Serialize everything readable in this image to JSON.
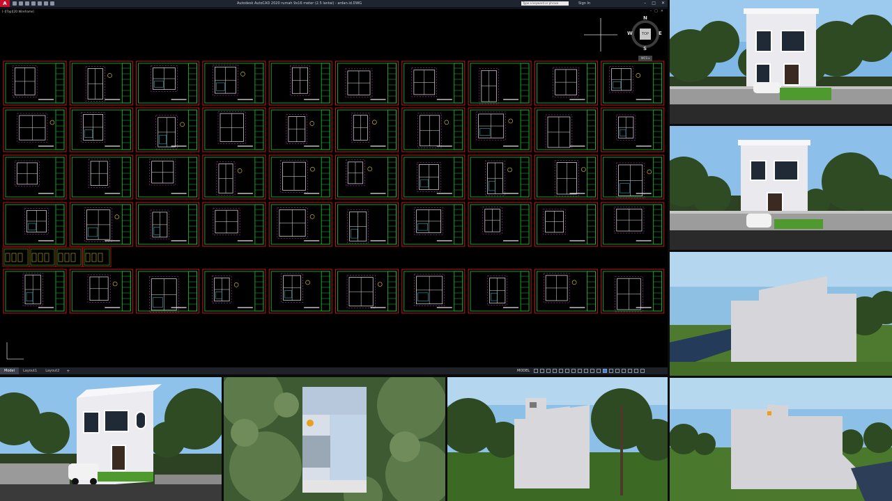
{
  "window": {
    "app_logo": "A",
    "title": "Autodesk AutoCAD 2020    rumah 9x16 meter (2.5 lantai) - ardan.id.DWG",
    "search_placeholder": "Type a keyword or phrase",
    "signin": "Sign In",
    "minimize": "–",
    "restore": "□",
    "close": "✕"
  },
  "viewport": {
    "label": "[–][Top][2D Wireframe]",
    "controls": [
      "–",
      "□",
      "✕"
    ]
  },
  "viewcube": {
    "face": "TOP",
    "n": "N",
    "s": "S",
    "e": "E",
    "w": "W",
    "wcs": "WCS ▾"
  },
  "statusbar": {
    "tabs": [
      "Model",
      "Layout1",
      "Layout2"
    ],
    "add": "+",
    "model": "MODEL"
  },
  "colors": {
    "frame_red": "#c81414",
    "frame_green": "#18c830",
    "plan_white": "#e6e6e6",
    "plan_magenta": "#d040d0",
    "plan_cyan": "#30d0e0",
    "plan_yellow": "#e6d020"
  }
}
